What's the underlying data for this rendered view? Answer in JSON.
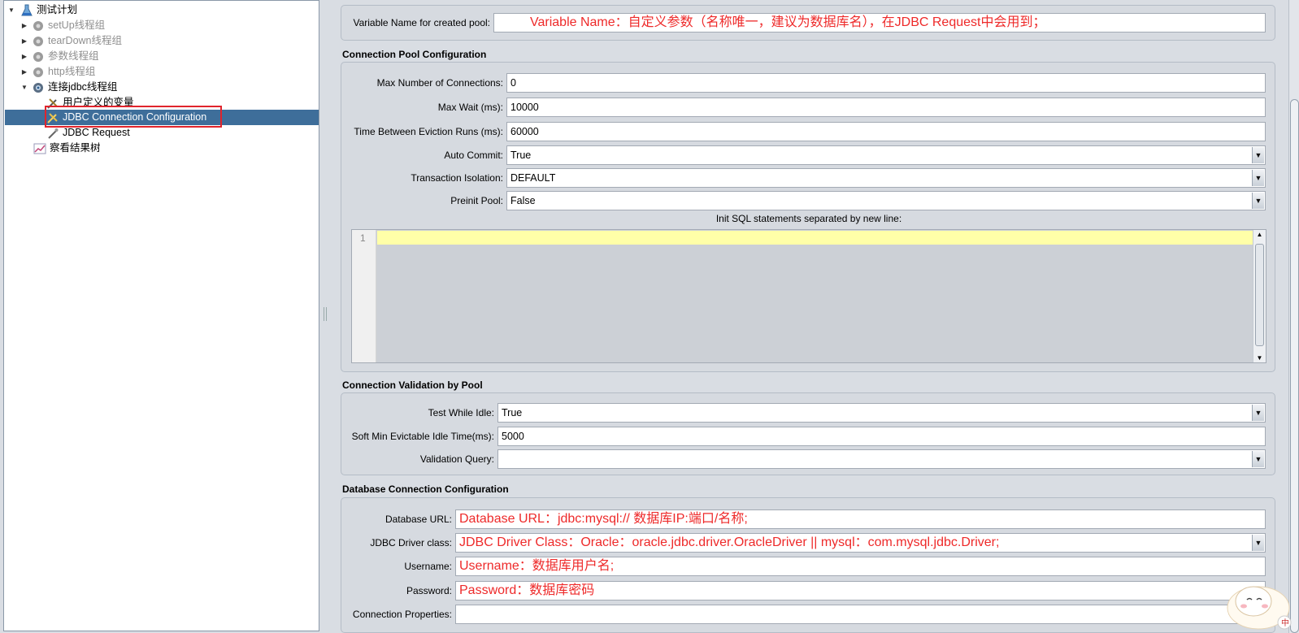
{
  "tree": {
    "items": [
      {
        "label": "测试计划"
      },
      {
        "label": "setUp线程组"
      },
      {
        "label": "tearDown线程组"
      },
      {
        "label": "参数线程组"
      },
      {
        "label": "http线程组"
      },
      {
        "label": "连接jdbc线程组"
      },
      {
        "label": "用户定义的变量"
      },
      {
        "label": "JDBC Connection Configuration"
      },
      {
        "label": "JDBC Request"
      },
      {
        "label": "察看结果树"
      }
    ]
  },
  "variable": {
    "label": "Variable Name for created pool:",
    "value": "Variable Name：自定义参数（名称唯一，建议为数据库名），在JDBC Request中会用到；"
  },
  "pool": {
    "title": "Connection Pool Configuration",
    "max_connections_label": "Max Number of Connections:",
    "max_connections": "0",
    "max_wait_label": "Max Wait (ms):",
    "max_wait": "10000",
    "eviction_label": "Time Between Eviction Runs (ms):",
    "eviction": "60000",
    "auto_commit_label": "Auto Commit:",
    "auto_commit": "True",
    "isolation_label": "Transaction Isolation:",
    "isolation": "DEFAULT",
    "preinit_label": "Preinit Pool:",
    "preinit": "False",
    "init_sql_label": "Init SQL statements separated by new line:",
    "init_sql_line": "1"
  },
  "validation": {
    "title": "Connection Validation by Pool",
    "test_idle_label": "Test While Idle:",
    "test_idle": "True",
    "soft_min_label": "Soft Min Evictable Idle Time(ms):",
    "soft_min": "5000",
    "query_label": "Validation Query:",
    "query": ""
  },
  "database": {
    "title": "Database Connection Configuration",
    "url_label": "Database URL:",
    "url": "Database URL：jdbc:mysql:// 数据库IP:端口/名称;",
    "driver_label": "JDBC Driver class:",
    "driver": "JDBC Driver Class：Oracle：oracle.jdbc.driver.OracleDriver   ||  mysql：com.mysql.jdbc.Driver;",
    "username_label": "Username:",
    "username": "Username：数据库用户名;",
    "password_label": "Password:",
    "password": "Password：数据库密码",
    "properties_label": "Connection Properties:",
    "properties": ""
  },
  "colors": {
    "annotation_red": "#ee2a2a",
    "selection_blue": "#3e6e9a",
    "highlight_box": "#e0242c",
    "editor_line": "#ffffa8"
  }
}
